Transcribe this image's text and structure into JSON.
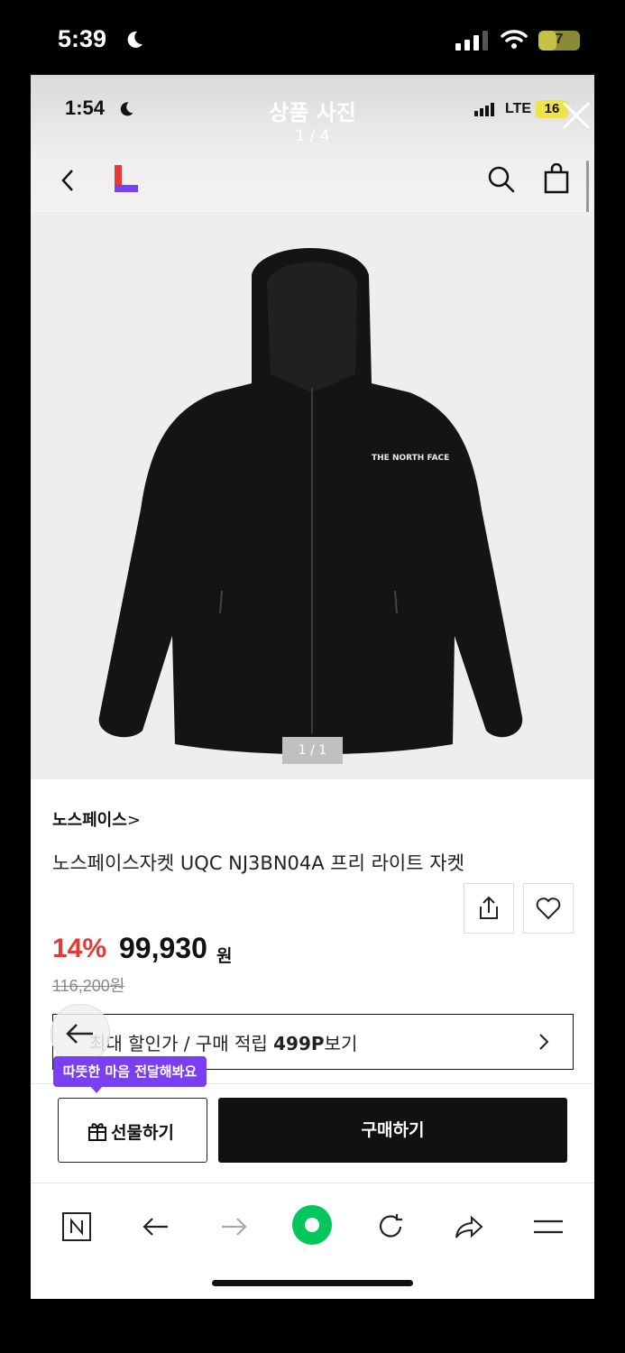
{
  "device_status": {
    "time": "5:39",
    "battery": "7"
  },
  "inner_status": {
    "time": "1:54",
    "network": "LTE",
    "battery": "16"
  },
  "viewer": {
    "title": "상품 사진",
    "counter": "1 / 4"
  },
  "photo": {
    "counter": "1 / 1"
  },
  "product": {
    "brand": "노스페이스",
    "brand_chevron": ">",
    "name": "노스페이스자켓 UQC NJ3BN04A 프리 라이트 자켓",
    "discount": "14%",
    "price": "99,930",
    "price_unit": "원",
    "original_price": "116,200원"
  },
  "benefit": {
    "prefix": "최대 할인가 / 구매 적립 ",
    "points": "499P",
    "suffix": "보기"
  },
  "tooltip": {
    "text": "따뜻한 마음 전달해봐요"
  },
  "actions": {
    "gift_label": "선물하기",
    "buy_label": "구매하기"
  },
  "browser_toolbar": {
    "icons": [
      "naver-n-icon",
      "back-arrow-icon",
      "forward-arrow-icon",
      "green-dot-icon",
      "refresh-icon",
      "share-arrow-icon",
      "menu-icon"
    ]
  },
  "colors": {
    "discount": "#e53935",
    "accent_purple": "#7a3ff2",
    "buy_button": "#111111",
    "green": "#03c75a"
  }
}
